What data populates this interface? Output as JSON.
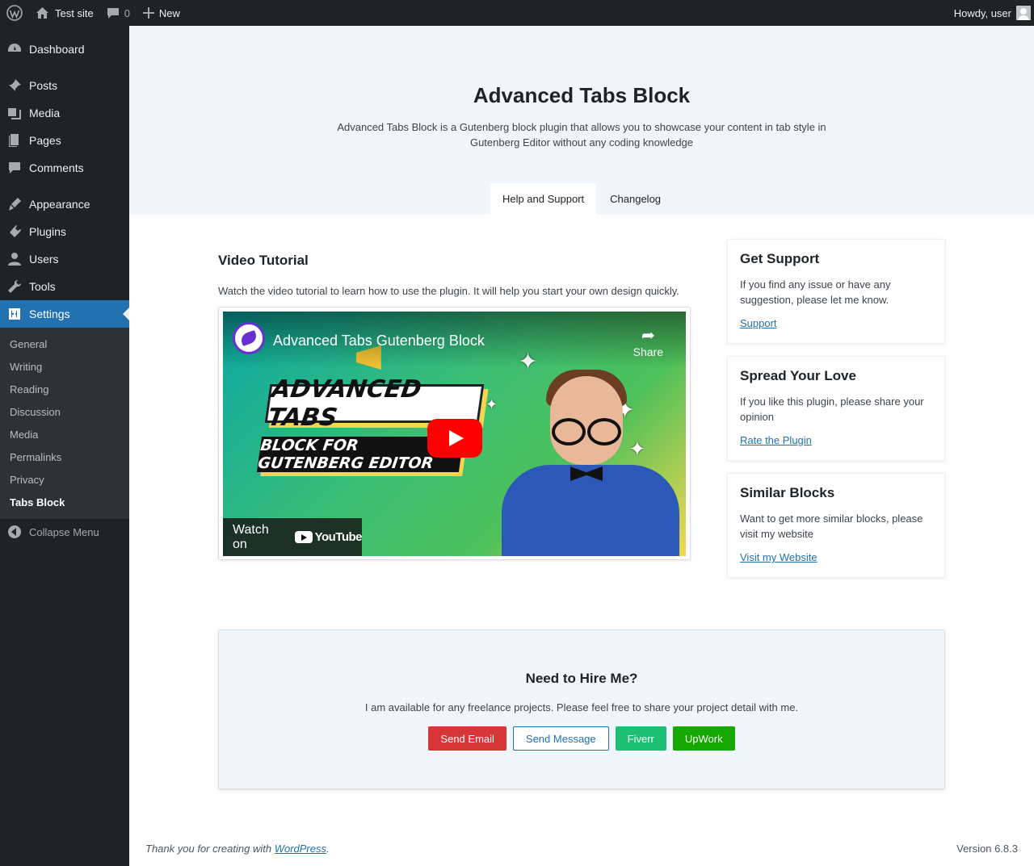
{
  "adminbar": {
    "site_name": "Test site",
    "comments_count": "0",
    "new_label": "New",
    "greeting": "Howdy, user"
  },
  "sidebar": {
    "items": [
      {
        "label": "Dashboard",
        "icon": "dashboard-icon"
      },
      {
        "label": "Posts",
        "icon": "pin-icon"
      },
      {
        "label": "Media",
        "icon": "media-icon"
      },
      {
        "label": "Pages",
        "icon": "pages-icon"
      },
      {
        "label": "Comments",
        "icon": "comment-icon"
      },
      {
        "label": "Appearance",
        "icon": "brush-icon"
      },
      {
        "label": "Plugins",
        "icon": "plug-icon"
      },
      {
        "label": "Users",
        "icon": "user-icon"
      },
      {
        "label": "Tools",
        "icon": "wrench-icon"
      },
      {
        "label": "Settings",
        "icon": "settings-icon",
        "current": true
      }
    ],
    "submenu": [
      "General",
      "Writing",
      "Reading",
      "Discussion",
      "Media",
      "Permalinks",
      "Privacy",
      "Tabs Block"
    ],
    "submenu_current": "Tabs Block",
    "collapse_label": "Collapse Menu"
  },
  "hero": {
    "title": "Advanced Tabs Block",
    "description": "Advanced Tabs Block is a Gutenberg block plugin that allows you to showcase your content in tab style in Gutenberg Editor without any coding knowledge",
    "tabs": [
      "Help and Support",
      "Changelog"
    ],
    "active_tab": "Help and Support"
  },
  "tutorial": {
    "heading": "Video Tutorial",
    "text": "Watch the video tutorial to learn how to use the plugin. It will help you start your own design quickly.",
    "video_title": "Advanced Tabs Gutenberg Block",
    "share_label": "Share",
    "banner_line1": "ADVANCED TABS",
    "banner_line2": "BLOCK FOR GUTENBERG EDITOR",
    "watch_on": "Watch on",
    "youtube": "YouTube"
  },
  "cards": [
    {
      "title": "Get Support",
      "text": "If you find any issue or have any suggestion, please let me know.",
      "link": "Support"
    },
    {
      "title": "Spread Your Love",
      "text": "If you like this plugin, please share your opinion",
      "link": "Rate the Plugin"
    },
    {
      "title": "Similar Blocks",
      "text": "Want to get more similar blocks, please visit my website",
      "link": "Visit my Website"
    }
  ],
  "hire": {
    "title": "Need to Hire Me?",
    "text": "I am available for any freelance projects. Please feel free to share your project detail with me.",
    "buttons": [
      "Send Email",
      "Send Message",
      "Fiverr",
      "UpWork"
    ]
  },
  "footer": {
    "thanks_prefix": "Thank you for creating with ",
    "link": "WordPress",
    "suffix": ".",
    "version": "Version 6.8.3"
  },
  "colors": {
    "admin_dark": "#1d2327",
    "accent_blue": "#2271b1",
    "send_email": "#d63638",
    "fiverr": "#1dbf73",
    "upwork": "#14a800",
    "youtube_red": "#ff0000"
  }
}
